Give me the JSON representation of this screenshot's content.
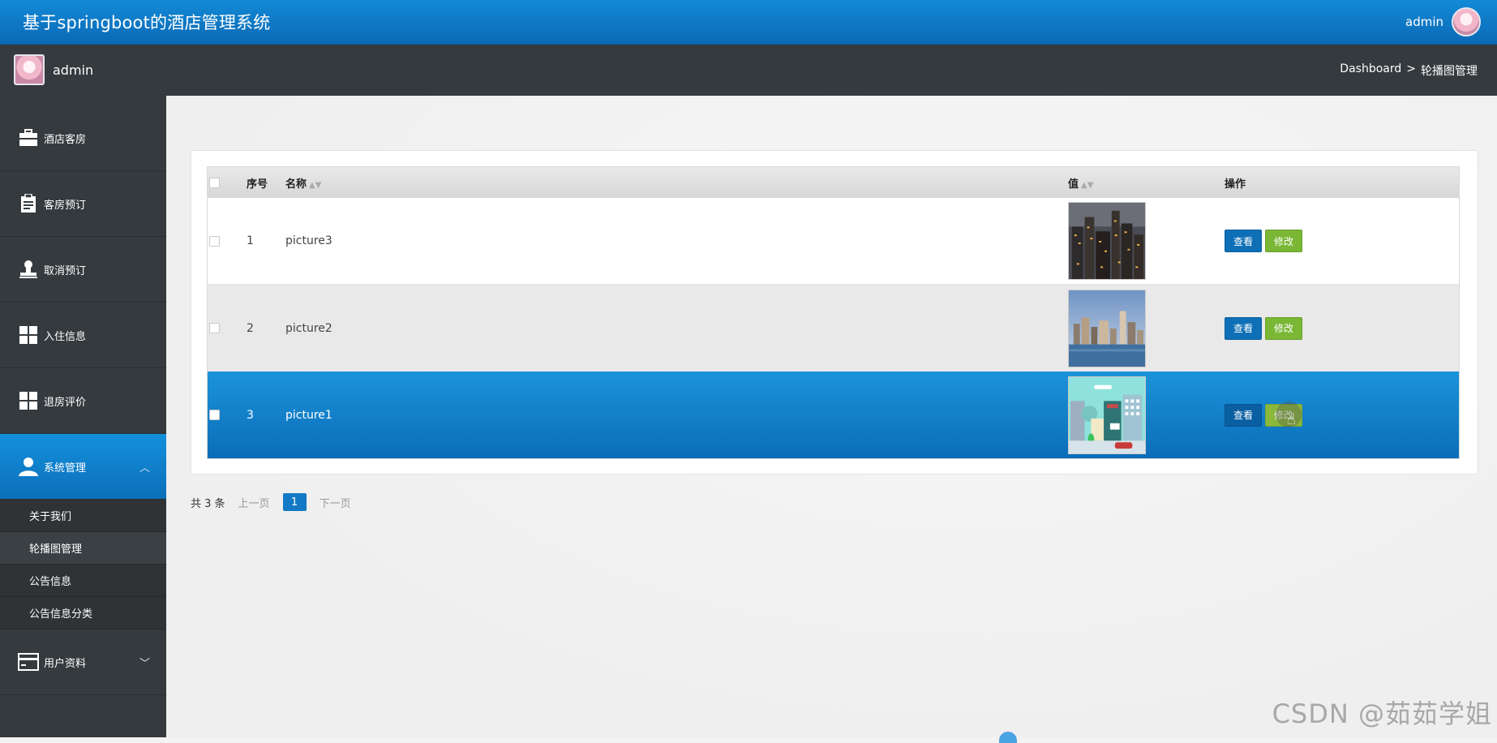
{
  "header": {
    "title": "基于springboot的酒店管理系统",
    "user": "admin"
  },
  "subbar": {
    "admin_name": "admin",
    "breadcrumb": {
      "root": "Dashboard",
      "sep": ">",
      "current": "轮播图管理"
    }
  },
  "sidebar": {
    "items": [
      {
        "label": "酒店客房",
        "icon": "briefcase-icon"
      },
      {
        "label": "客房预订",
        "icon": "clipboard-icon"
      },
      {
        "label": "取消预订",
        "icon": "stamp-icon"
      },
      {
        "label": "入住信息",
        "icon": "grid-icon"
      },
      {
        "label": "退房评价",
        "icon": "grid-icon"
      },
      {
        "label": "系统管理",
        "icon": "user-icon",
        "chevron": "^"
      },
      {
        "label": "用户资料",
        "icon": "card-icon",
        "chevron": "v"
      }
    ],
    "submenu": [
      {
        "label": "关于我们"
      },
      {
        "label": "轮播图管理"
      },
      {
        "label": "公告信息"
      },
      {
        "label": "公告信息分类"
      }
    ]
  },
  "table": {
    "columns": {
      "no": "序号",
      "name": "名称",
      "value": "值",
      "ops": "操作"
    },
    "rows": [
      {
        "no": "1",
        "name": "picture3",
        "image": "city-night-image"
      },
      {
        "no": "2",
        "name": "picture2",
        "image": "city-skyline-water-image"
      },
      {
        "no": "3",
        "name": "picture1",
        "image": "cartoon-city-image"
      }
    ],
    "view_label": "查看",
    "edit_label": "修改"
  },
  "pager": {
    "total": "共 3 条",
    "prev": "上一页",
    "page": "1",
    "next": "下一页"
  },
  "watermark": "CSDN @茹茹学姐",
  "colors": {
    "header_blue": "#0b69b6",
    "sidebar_dark": "#353a3e",
    "active_blue": "#1490dc",
    "view_button": "#0e6fb6",
    "edit_button": "#7ab735"
  }
}
